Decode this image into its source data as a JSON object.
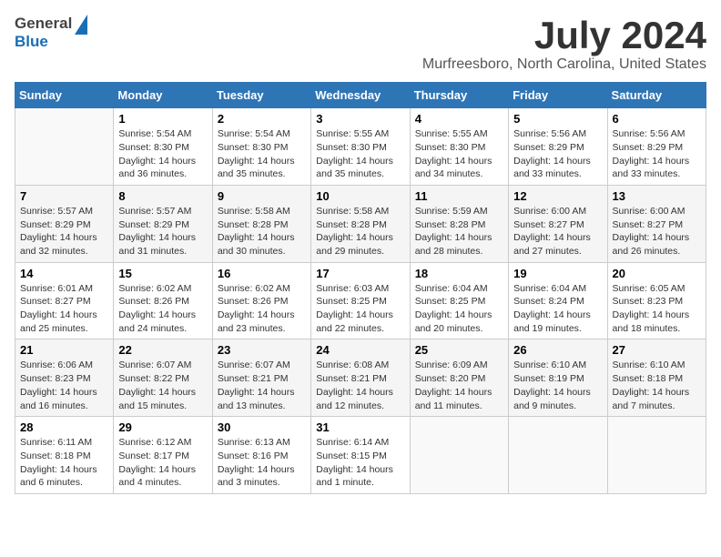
{
  "logo": {
    "text1": "General",
    "text2": "Blue"
  },
  "title": "July 2024",
  "subtitle": "Murfreesboro, North Carolina, United States",
  "calendar": {
    "headers": [
      "Sunday",
      "Monday",
      "Tuesday",
      "Wednesday",
      "Thursday",
      "Friday",
      "Saturday"
    ],
    "rows": [
      [
        {
          "day": "",
          "content": ""
        },
        {
          "day": "1",
          "content": "Sunrise: 5:54 AM\nSunset: 8:30 PM\nDaylight: 14 hours\nand 36 minutes."
        },
        {
          "day": "2",
          "content": "Sunrise: 5:54 AM\nSunset: 8:30 PM\nDaylight: 14 hours\nand 35 minutes."
        },
        {
          "day": "3",
          "content": "Sunrise: 5:55 AM\nSunset: 8:30 PM\nDaylight: 14 hours\nand 35 minutes."
        },
        {
          "day": "4",
          "content": "Sunrise: 5:55 AM\nSunset: 8:30 PM\nDaylight: 14 hours\nand 34 minutes."
        },
        {
          "day": "5",
          "content": "Sunrise: 5:56 AM\nSunset: 8:29 PM\nDaylight: 14 hours\nand 33 minutes."
        },
        {
          "day": "6",
          "content": "Sunrise: 5:56 AM\nSunset: 8:29 PM\nDaylight: 14 hours\nand 33 minutes."
        }
      ],
      [
        {
          "day": "7",
          "content": "Sunrise: 5:57 AM\nSunset: 8:29 PM\nDaylight: 14 hours\nand 32 minutes."
        },
        {
          "day": "8",
          "content": "Sunrise: 5:57 AM\nSunset: 8:29 PM\nDaylight: 14 hours\nand 31 minutes."
        },
        {
          "day": "9",
          "content": "Sunrise: 5:58 AM\nSunset: 8:28 PM\nDaylight: 14 hours\nand 30 minutes."
        },
        {
          "day": "10",
          "content": "Sunrise: 5:58 AM\nSunset: 8:28 PM\nDaylight: 14 hours\nand 29 minutes."
        },
        {
          "day": "11",
          "content": "Sunrise: 5:59 AM\nSunset: 8:28 PM\nDaylight: 14 hours\nand 28 minutes."
        },
        {
          "day": "12",
          "content": "Sunrise: 6:00 AM\nSunset: 8:27 PM\nDaylight: 14 hours\nand 27 minutes."
        },
        {
          "day": "13",
          "content": "Sunrise: 6:00 AM\nSunset: 8:27 PM\nDaylight: 14 hours\nand 26 minutes."
        }
      ],
      [
        {
          "day": "14",
          "content": "Sunrise: 6:01 AM\nSunset: 8:27 PM\nDaylight: 14 hours\nand 25 minutes."
        },
        {
          "day": "15",
          "content": "Sunrise: 6:02 AM\nSunset: 8:26 PM\nDaylight: 14 hours\nand 24 minutes."
        },
        {
          "day": "16",
          "content": "Sunrise: 6:02 AM\nSunset: 8:26 PM\nDaylight: 14 hours\nand 23 minutes."
        },
        {
          "day": "17",
          "content": "Sunrise: 6:03 AM\nSunset: 8:25 PM\nDaylight: 14 hours\nand 22 minutes."
        },
        {
          "day": "18",
          "content": "Sunrise: 6:04 AM\nSunset: 8:25 PM\nDaylight: 14 hours\nand 20 minutes."
        },
        {
          "day": "19",
          "content": "Sunrise: 6:04 AM\nSunset: 8:24 PM\nDaylight: 14 hours\nand 19 minutes."
        },
        {
          "day": "20",
          "content": "Sunrise: 6:05 AM\nSunset: 8:23 PM\nDaylight: 14 hours\nand 18 minutes."
        }
      ],
      [
        {
          "day": "21",
          "content": "Sunrise: 6:06 AM\nSunset: 8:23 PM\nDaylight: 14 hours\nand 16 minutes."
        },
        {
          "day": "22",
          "content": "Sunrise: 6:07 AM\nSunset: 8:22 PM\nDaylight: 14 hours\nand 15 minutes."
        },
        {
          "day": "23",
          "content": "Sunrise: 6:07 AM\nSunset: 8:21 PM\nDaylight: 14 hours\nand 13 minutes."
        },
        {
          "day": "24",
          "content": "Sunrise: 6:08 AM\nSunset: 8:21 PM\nDaylight: 14 hours\nand 12 minutes."
        },
        {
          "day": "25",
          "content": "Sunrise: 6:09 AM\nSunset: 8:20 PM\nDaylight: 14 hours\nand 11 minutes."
        },
        {
          "day": "26",
          "content": "Sunrise: 6:10 AM\nSunset: 8:19 PM\nDaylight: 14 hours\nand 9 minutes."
        },
        {
          "day": "27",
          "content": "Sunrise: 6:10 AM\nSunset: 8:18 PM\nDaylight: 14 hours\nand 7 minutes."
        }
      ],
      [
        {
          "day": "28",
          "content": "Sunrise: 6:11 AM\nSunset: 8:18 PM\nDaylight: 14 hours\nand 6 minutes."
        },
        {
          "day": "29",
          "content": "Sunrise: 6:12 AM\nSunset: 8:17 PM\nDaylight: 14 hours\nand 4 minutes."
        },
        {
          "day": "30",
          "content": "Sunrise: 6:13 AM\nSunset: 8:16 PM\nDaylight: 14 hours\nand 3 minutes."
        },
        {
          "day": "31",
          "content": "Sunrise: 6:14 AM\nSunset: 8:15 PM\nDaylight: 14 hours\nand 1 minute."
        },
        {
          "day": "",
          "content": ""
        },
        {
          "day": "",
          "content": ""
        },
        {
          "day": "",
          "content": ""
        }
      ]
    ]
  }
}
